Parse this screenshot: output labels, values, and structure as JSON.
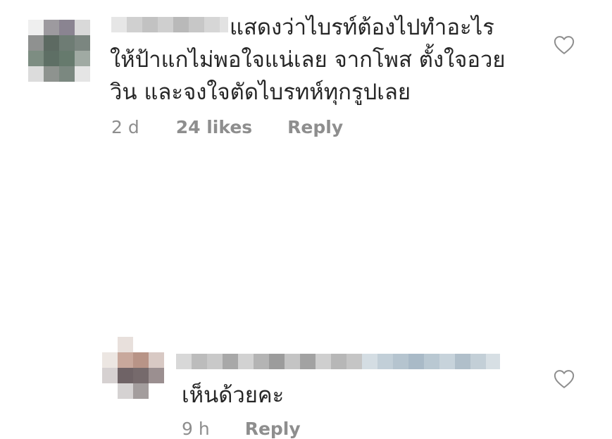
{
  "comments": [
    {
      "text_first_line": "แสดงว่าไบรท์ต้องไปทำอะไร",
      "text_rest": "ให้ป้าแกไม่พอใจแน่เลย จากโพส ตั้งใจอวย\nวิน และจงใจตัดไบรทห์ทุกรูปเลย",
      "time": "2 d",
      "likes": "24 likes",
      "reply": "Reply",
      "like_icon": "heart-outline-icon"
    },
    {
      "text": "เห็นด้วยคะ",
      "time": "9 h",
      "reply": "Reply",
      "like_icon": "heart-outline-icon"
    }
  ],
  "colors": {
    "text": "#262626",
    "meta": "#8e8e8e",
    "background": "#ffffff"
  }
}
